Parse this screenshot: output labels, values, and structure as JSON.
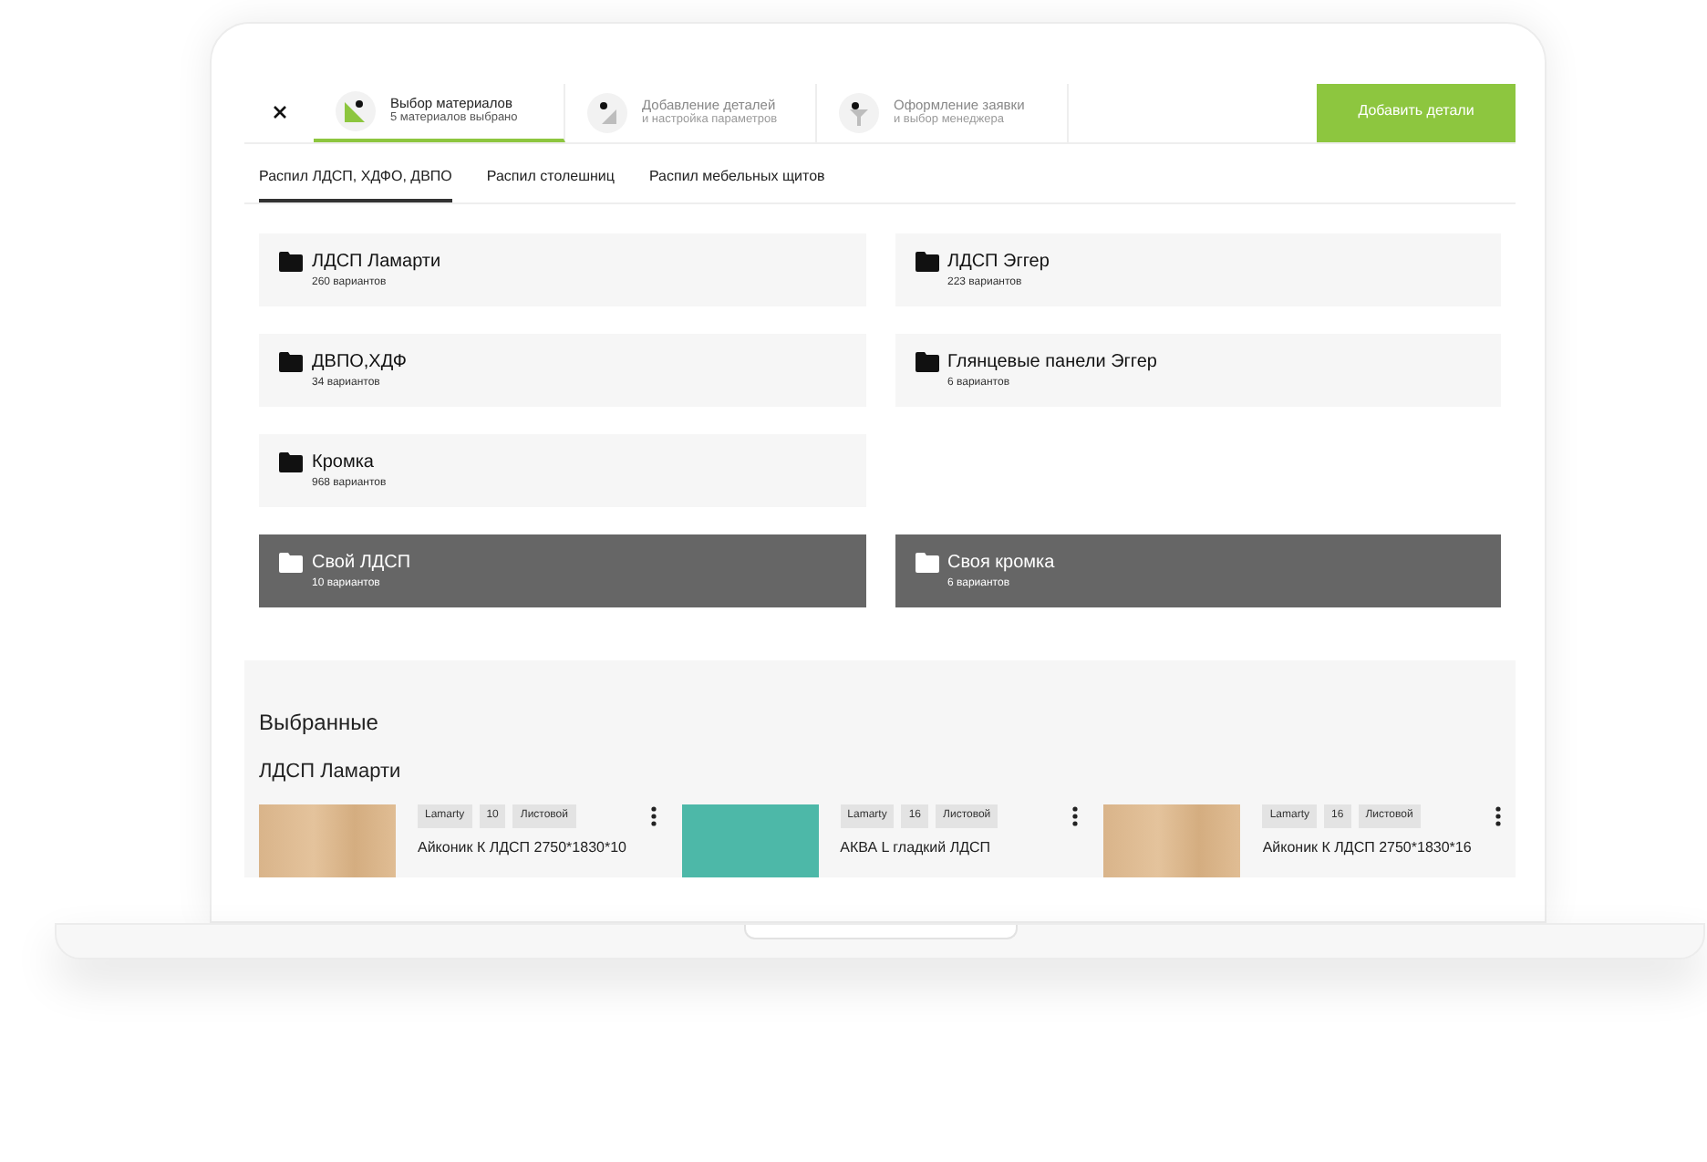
{
  "steps": [
    {
      "title": "Выбор материалов",
      "subtitle": "5 материалов выбрано",
      "selected": true
    },
    {
      "title": "Добавление деталей",
      "subtitle": "и настройка параметров",
      "selected": false
    },
    {
      "title": "Оформление заявки",
      "subtitle": "и выбор менеджера",
      "selected": false
    }
  ],
  "add_button": "Добавить детали",
  "tabs": [
    {
      "label": "Распил ЛДСП, ХДФО, ДВПО",
      "selected": true
    },
    {
      "label": "Распил столешниц",
      "selected": false
    },
    {
      "label": "Распил мебельных щитов",
      "selected": false
    }
  ],
  "categories": [
    {
      "name": "ЛДСП Ламарти",
      "count": "260 вариантов",
      "kind": "standard"
    },
    {
      "name": "ЛДСП Эггер",
      "count": "223 вариантов",
      "kind": "standard"
    },
    {
      "name": "ДВПО,ХДФ",
      "count": "34 вариантов",
      "kind": "standard"
    },
    {
      "name": "Глянцевые панели Эггер",
      "count": "6 вариантов",
      "kind": "standard"
    },
    {
      "name": "Кромка",
      "count": "968 вариантов",
      "kind": "standard"
    },
    {
      "name": "Свой ЛДСП",
      "count": "10 вариантов",
      "kind": "custom"
    },
    {
      "name": "Своя кромка",
      "count": "6 вариантов",
      "kind": "custom"
    }
  ],
  "selected_section": {
    "title": "Выбранные",
    "group_title": "ЛДСП Ламарти",
    "materials": [
      {
        "kind": "wood",
        "tags": [
          "Lamarty",
          "10",
          "Листовой"
        ],
        "title": "Айконик К ЛДСП 2750*1830*10"
      },
      {
        "kind": "solid",
        "color": "#4db8a8",
        "tags": [
          "Lamarty",
          "16",
          "Листовой"
        ],
        "title": "АКВА L гладкий ЛДСП"
      },
      {
        "kind": "wood",
        "tags": [
          "Lamarty",
          "16",
          "Листовой"
        ],
        "title": "Айконик К ЛДСП 2750*1830*16"
      }
    ]
  }
}
